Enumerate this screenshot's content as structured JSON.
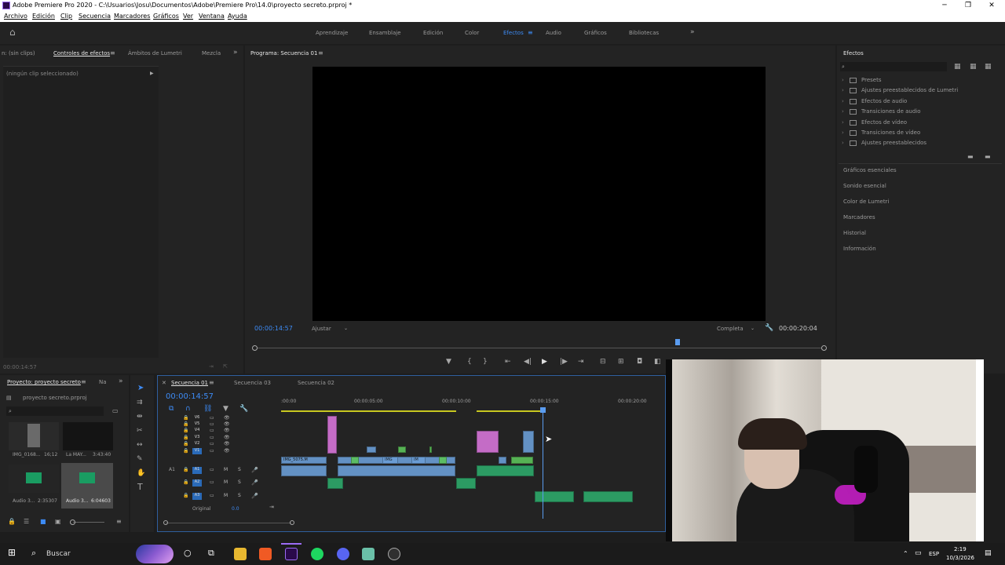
{
  "window": {
    "title": "Adobe Premiere Pro 2020 - C:\\Usuarios\\Josu\\Documentos\\Adobe\\Premiere Pro\\14.0\\proyecto secreto.prproj *",
    "min": "─",
    "max": "❐",
    "close": "✕"
  },
  "menu": [
    "Archivo",
    "Edición",
    "Clip",
    "Secuencia",
    "Marcadores",
    "Gráficos",
    "Ver",
    "Ventana",
    "Ayuda"
  ],
  "workspaces": [
    "Aprendizaje",
    "Ensamblaje",
    "Edición",
    "Color",
    "Efectos",
    "Audio",
    "Gráficos",
    "Bibliotecas"
  ],
  "active_workspace": "Efectos",
  "source_panel": {
    "tabs": [
      "n: (sin clips)",
      "Controles de efectos",
      "Ámbitos de Lumetri",
      "Mezcla"
    ],
    "no_clip": "(ningún clip seleccionado)",
    "timecode": "00:00:14:57"
  },
  "program_monitor": {
    "tab": "Programa: Secuencia 01",
    "timecode_current": "00:00:14:57",
    "fit": "Ajustar",
    "resolution": "Completa",
    "timecode_duration": "00:00:20:04"
  },
  "effects_panel": {
    "title": "Efectos",
    "tree": [
      "Presets",
      "Ajustes preestablecidos de Lumetri",
      "Efectos de audio",
      "Transiciones de audio",
      "Efectos de vídeo",
      "Transiciones de vídeo",
      "Ajustes preestablecidos"
    ],
    "collapsed_panels": [
      "Gráficos esenciales",
      "Sonido esencial",
      "Color de Lumetri",
      "Marcadores",
      "Historial",
      "Información"
    ]
  },
  "project_panel": {
    "tabs": [
      "Proyecto: proyecto secreto",
      "Na"
    ],
    "file": "proyecto secreto.prproj",
    "items": [
      {
        "name": "IMG_0168...",
        "duration": "16;12"
      },
      {
        "name": "La MAY...",
        "duration": "3:43:40"
      },
      {
        "name": "Audio 3...",
        "duration": "2:35307"
      },
      {
        "name": "Audio 3...",
        "duration": "6:04603"
      }
    ]
  },
  "timeline": {
    "tabs": [
      "Secuencia 01",
      "Secuencia 03",
      "Secuencia 02"
    ],
    "timecode": "00:00:14:57",
    "ruler": [
      ":00:00",
      "00:00:05:00",
      "00:00:10:00",
      "00:00:15:00",
      "00:00:20:00"
    ],
    "video_tracks": [
      "V6",
      "V5",
      "V4",
      "V3",
      "V2",
      "V1"
    ],
    "audio_tracks": [
      "A1",
      "A2",
      "A3"
    ],
    "source_patch": "A1",
    "mix_label": "Original",
    "mix_value": "0.0",
    "clip_labels": [
      "IMG_5075.M",
      "IMG",
      "IM"
    ],
    "track_buttons": {
      "m": "M",
      "s": "S"
    }
  },
  "taskbar": {
    "search": "Buscar",
    "lang": "ESP",
    "time": "2:19",
    "date": "10/3/2026"
  },
  "colors": {
    "accent": "#3d8bf5",
    "clip_video": "#6b9ed6",
    "clip_audio": "#2ea86a",
    "clip_pink": "#d675d8",
    "clip_green": "#5cc25a",
    "playhead": "#5a9cf0"
  }
}
